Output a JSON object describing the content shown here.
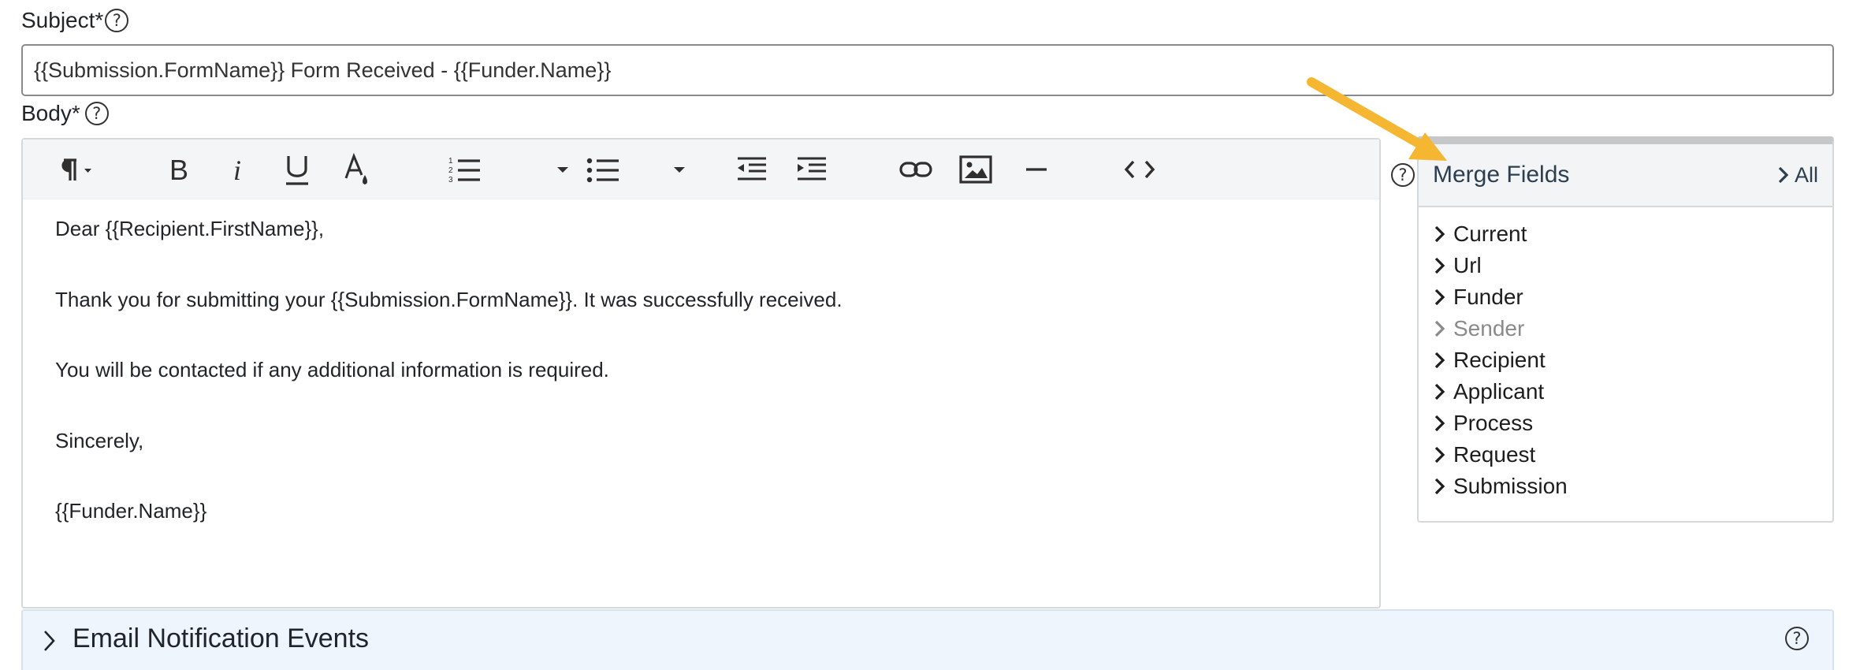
{
  "subject": {
    "label": "Subject*",
    "help": "?",
    "value": "{{Submission.FormName}} Form Received - {{Funder.Name}}"
  },
  "body": {
    "label": "Body*",
    "help": "?",
    "toolbar": [
      "paragraph-format",
      "bold",
      "italic",
      "underline",
      "text-color",
      "ordered-list",
      "ordered-list-dropdown",
      "bullet-list",
      "bullet-list-dropdown",
      "outdent",
      "indent",
      "link",
      "image",
      "horizontal-rule",
      "code-view"
    ],
    "paragraphs": [
      "Dear {{Recipient.FirstName}},",
      "Thank you for submitting your {{Submission.FormName}}. It was successfully received.",
      "You will be contacted if any additional information is required.",
      "Sincerely,",
      "{{Funder.Name}}"
    ]
  },
  "merge_fields": {
    "help": "?",
    "title": "Merge Fields",
    "all_label": "All",
    "items": [
      {
        "label": "Current",
        "enabled": true
      },
      {
        "label": "Url",
        "enabled": true
      },
      {
        "label": "Funder",
        "enabled": true
      },
      {
        "label": "Sender",
        "enabled": false
      },
      {
        "label": "Recipient",
        "enabled": true
      },
      {
        "label": "Applicant",
        "enabled": true
      },
      {
        "label": "Process",
        "enabled": true
      },
      {
        "label": "Request",
        "enabled": true
      },
      {
        "label": "Submission",
        "enabled": true
      }
    ]
  },
  "email_events": {
    "title": "Email Notification Events",
    "help": "?"
  },
  "colors": {
    "annotation_arrow": "#f5b632",
    "section_bg": "#eef5fd",
    "disabled_text": "#8a8a8a"
  }
}
